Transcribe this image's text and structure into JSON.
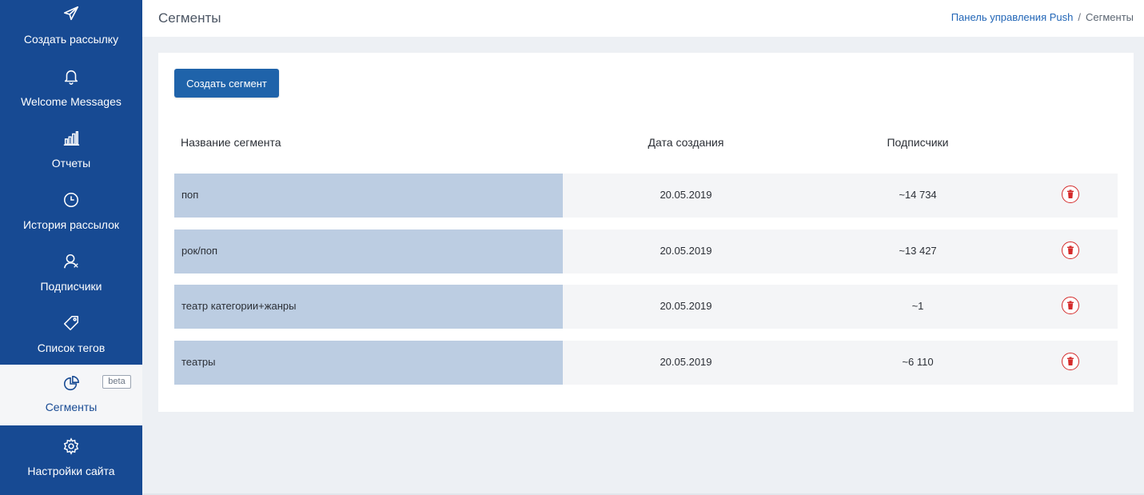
{
  "sidebar": {
    "items": [
      {
        "label": "Создать рассылку",
        "icon": "send-icon"
      },
      {
        "label": "Welcome Messages",
        "icon": "bell-icon"
      },
      {
        "label": "Отчеты",
        "icon": "bar-chart-icon"
      },
      {
        "label": "История рассылок",
        "icon": "clock-icon"
      },
      {
        "label": "Подписчики",
        "icon": "user-icon"
      },
      {
        "label": "Список тегов",
        "icon": "tag-icon"
      },
      {
        "label": "Сегменты",
        "icon": "pie-chart-icon",
        "badge": "beta",
        "active": true
      },
      {
        "label": "Настройки сайта",
        "icon": "gear-icon"
      }
    ]
  },
  "header": {
    "title": "Сегменты",
    "breadcrumb": {
      "link": "Панель управления Push",
      "separator": "/",
      "current": "Сегменты"
    }
  },
  "main": {
    "create_button": "Создать сегмент",
    "columns": {
      "name": "Название сегмента",
      "date": "Дата создания",
      "subscribers": "Подписчики"
    },
    "rows": [
      {
        "name": "поп",
        "date": "20.05.2019",
        "subscribers": "~14 734"
      },
      {
        "name": "рок/поп",
        "date": "20.05.2019",
        "subscribers": "~13 427"
      },
      {
        "name": "театр категории+жанры",
        "date": "20.05.2019",
        "subscribers": "~1"
      },
      {
        "name": "театры",
        "date": "20.05.2019",
        "subscribers": "~6 110"
      }
    ]
  },
  "colors": {
    "sidebar_bg": "#174a93",
    "accent": "#1f63aa",
    "delete": "#d42a2a",
    "name_cell_bg": "#bccde2"
  }
}
